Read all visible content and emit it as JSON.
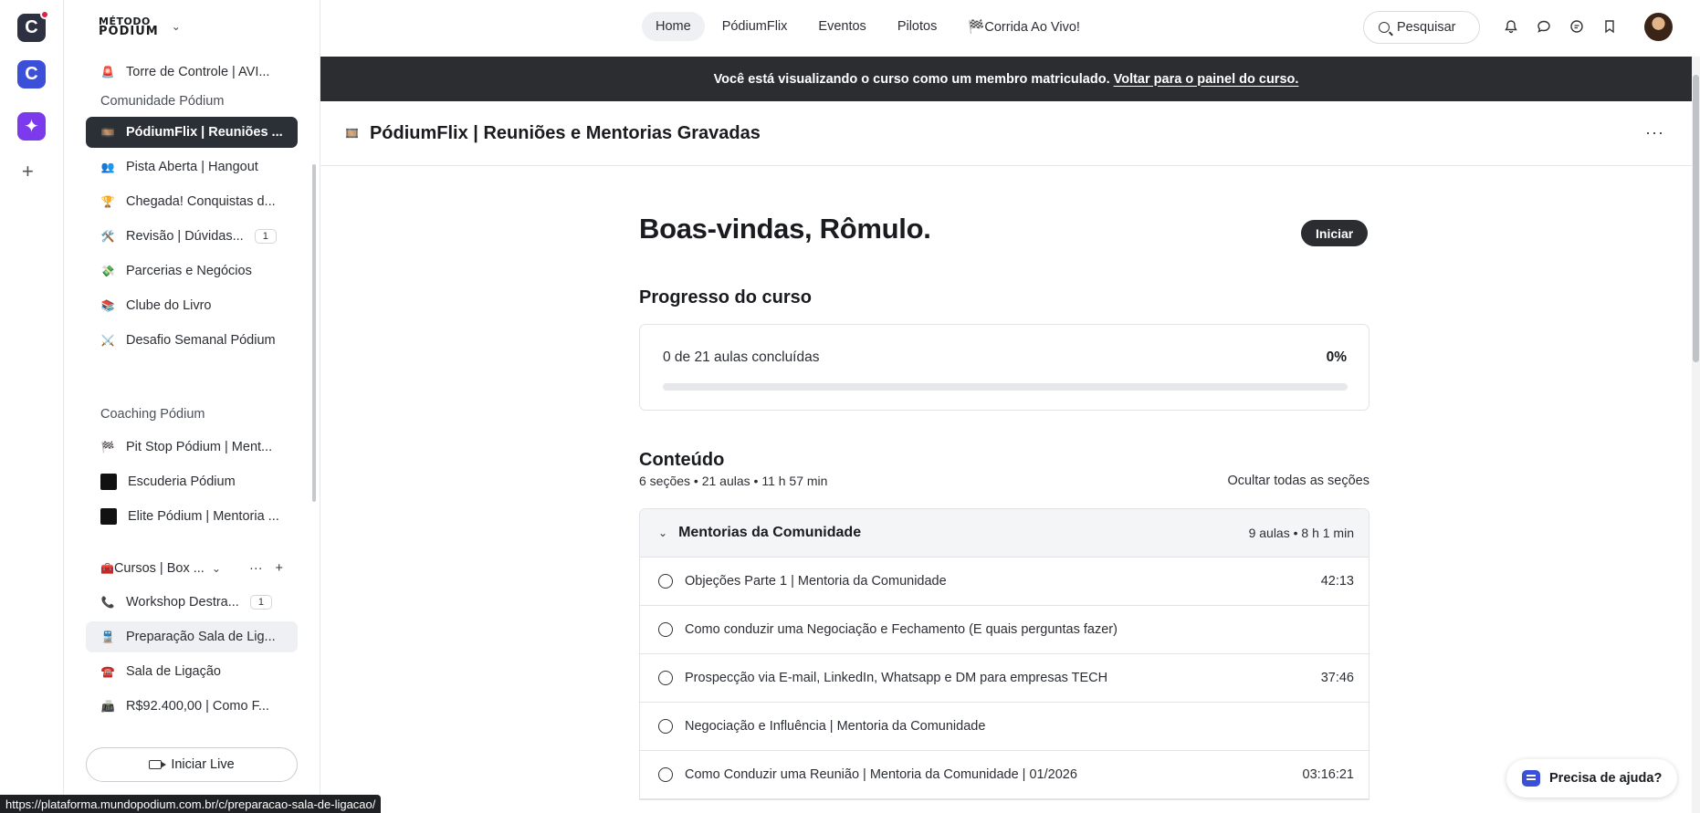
{
  "rail": {
    "apps": [
      "C",
      "C",
      "✦"
    ],
    "add": "+"
  },
  "sidebar": {
    "logo_top": "MÉTODO",
    "logo_bottom": "PÓDIUM",
    "items_top": [
      {
        "emoji": "🚨",
        "label": "Torre de Controle | AVI..."
      }
    ],
    "group_comunidade": "Comunidade Pódium",
    "comunidade_items": [
      {
        "emoji": "🎞️",
        "label": "PódiumFlix | Reuniões ..."
      },
      {
        "emoji": "👥",
        "label": "Pista Aberta | Hangout"
      },
      {
        "emoji": "🏆",
        "label": "Chegada! Conquistas d..."
      },
      {
        "emoji": "🛠️",
        "label": "Revisão | Dúvidas...",
        "badge": "1"
      },
      {
        "emoji": "💸",
        "label": "Parcerias e Negócios"
      },
      {
        "emoji": "📚",
        "label": "Clube do Livro"
      },
      {
        "emoji": "⚔️",
        "label": "Desafio Semanal Pódium"
      }
    ],
    "group_coaching": "Coaching Pódium",
    "coaching_items": [
      {
        "emoji": "🏁",
        "label": "Pit Stop Pódium | Ment..."
      },
      {
        "label": "Escuderia Pódium"
      },
      {
        "label": "Elite Pódium | Mentoria ..."
      }
    ],
    "group_cursos": "Cursos | Box ...",
    "group_cursos_emoji": "🧰",
    "cursos_items": [
      {
        "emoji": "📞",
        "label": "Workshop Destra...",
        "badge": "1"
      },
      {
        "emoji": "🚆",
        "label": "Preparação Sala de Lig..."
      },
      {
        "emoji": "☎️",
        "label": "Sala de Ligação"
      },
      {
        "emoji": "📠",
        "label": "R$92.400,00 | Como F..."
      }
    ],
    "live_button": "Iniciar Live"
  },
  "nav": {
    "items": [
      "Home",
      "PódiumFlix",
      "Eventos",
      "Pilotos",
      "🏁Corrida Ao Vivo!"
    ],
    "search": "Pesquisar"
  },
  "banner": {
    "text": "Você está visualizando o curso como um membro matriculado.",
    "link": "Voltar para o painel do curso."
  },
  "page": {
    "emoji": "🎞️",
    "title": "PódiumFlix | Reuniões e Mentorias Gravadas",
    "more": "···"
  },
  "course": {
    "welcome": "Boas-vindas, Rômulo.",
    "start_button": "Iniciar",
    "progress_heading": "Progresso do curso",
    "progress_text": "0 de 21 aulas concluídas",
    "progress_pct_label": "0%",
    "progress_fraction": 0,
    "content_heading": "Conteúdo",
    "content_meta": "6 seções • 21 aulas • 11 h 57 min",
    "hide_all": "Ocultar todas as seções",
    "section": {
      "title": "Mentorias da Comunidade",
      "meta": "9 aulas • 8 h 1 min",
      "lessons": [
        {
          "title": "Objeções Parte 1 | Mentoria da Comunidade",
          "duration": "42:13"
        },
        {
          "title": "Como conduzir uma Negociação e Fechamento (E quais perguntas fazer)",
          "duration": ""
        },
        {
          "title": "Prospecção via E-mail, LinkedIn, Whatsapp e DM para empresas TECH",
          "duration": "37:46"
        },
        {
          "title": "Negociação e Influência | Mentoria da Comunidade",
          "duration": ""
        },
        {
          "title": "Como Conduzir uma Reunião | Mentoria da Comunidade | 01/2026",
          "duration": "03:16:21"
        }
      ]
    }
  },
  "help": "Precisa de ajuda?",
  "status_url": "https://plataforma.mundopodium.com.br/c/preparacao-sala-de-ligacao/"
}
